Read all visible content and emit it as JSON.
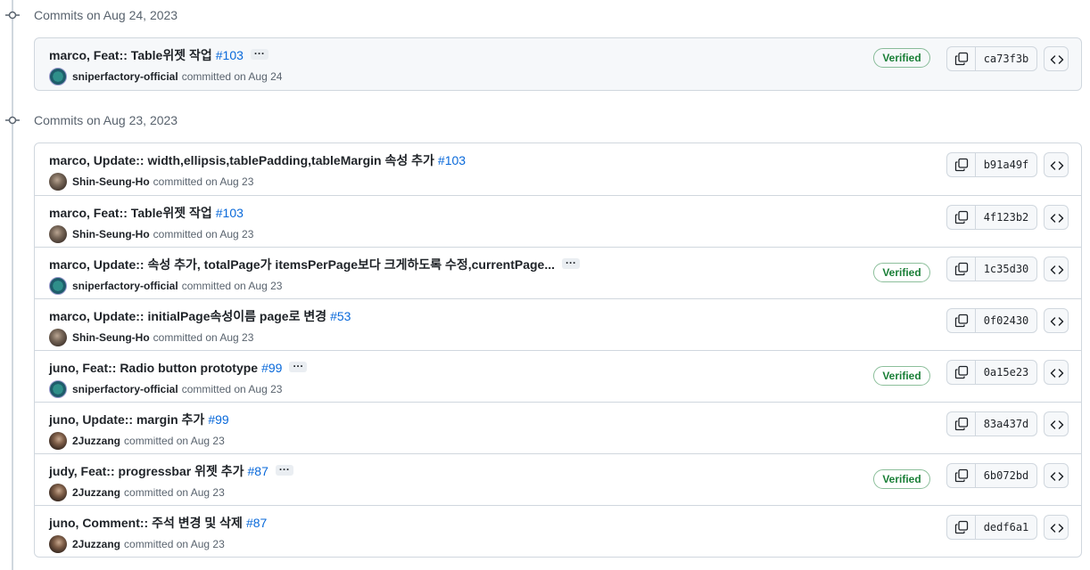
{
  "groups": [
    {
      "title": "Commits on Aug 24, 2023",
      "commits": [
        {
          "message": "marco, Feat:: Table위젯 작업",
          "pr": "#103",
          "ellipsis": true,
          "author": "sniperfactory-official",
          "avatar": "org",
          "date_text": "committed on Aug 24",
          "verified": "Verified",
          "sha": "ca73f3b"
        }
      ]
    },
    {
      "title": "Commits on Aug 23, 2023",
      "commits": [
        {
          "message": "marco, Update:: width,ellipsis,tablePadding,tableMargin 속성 추가",
          "pr": "#103",
          "ellipsis": false,
          "author": "Shin-Seung-Ho",
          "avatar": "person1",
          "date_text": "committed on Aug 23",
          "verified": "",
          "sha": "b91a49f"
        },
        {
          "message": "marco, Feat:: Table위젯 작업",
          "pr": "#103",
          "ellipsis": false,
          "author": "Shin-Seung-Ho",
          "avatar": "person1",
          "date_text": "committed on Aug 23",
          "verified": "",
          "sha": "4f123b2"
        },
        {
          "message": "marco, Update:: 속성 추가, totalPage가 itemsPerPage보다 크게하도록 수정,currentPage...",
          "pr": "",
          "ellipsis": true,
          "author": "sniperfactory-official",
          "avatar": "org",
          "date_text": "committed on Aug 23",
          "verified": "Verified",
          "sha": "1c35d30"
        },
        {
          "message": "marco, Update:: initialPage속성이름 page로 변경",
          "pr": "#53",
          "ellipsis": false,
          "author": "Shin-Seung-Ho",
          "avatar": "person1",
          "date_text": "committed on Aug 23",
          "verified": "",
          "sha": "0f02430"
        },
        {
          "message": "juno, Feat:: Radio button prototype",
          "pr": "#99",
          "ellipsis": true,
          "author": "sniperfactory-official",
          "avatar": "org",
          "date_text": "committed on Aug 23",
          "verified": "Verified",
          "sha": "0a15e23"
        },
        {
          "message": "juno, Update:: margin 추가",
          "pr": "#99",
          "ellipsis": false,
          "author": "2Juzzang",
          "avatar": "person2",
          "date_text": "committed on Aug 23",
          "verified": "",
          "sha": "83a437d"
        },
        {
          "message": "judy, Feat:: progressbar 위젯 추가",
          "pr": "#87",
          "ellipsis": true,
          "author": "2Juzzang",
          "avatar": "person2",
          "date_text": "committed on Aug 23",
          "verified": "Verified",
          "sha": "6b072bd"
        },
        {
          "message": "juno, Comment:: 주석 변경 및 삭제",
          "pr": "#87",
          "ellipsis": false,
          "author": "2Juzzang",
          "avatar": "person2",
          "date_text": "committed on Aug 23",
          "verified": "",
          "sha": "dedf6a1"
        }
      ]
    }
  ],
  "icons": {
    "commit": "git-commit-icon",
    "copy": "copy-icon",
    "browse": "code-icon",
    "more": "ellipsis-icon"
  },
  "colors": {
    "link": "#0969da",
    "verified": "#1a7f37",
    "border": "#d0d7de",
    "muted": "#59636e"
  }
}
